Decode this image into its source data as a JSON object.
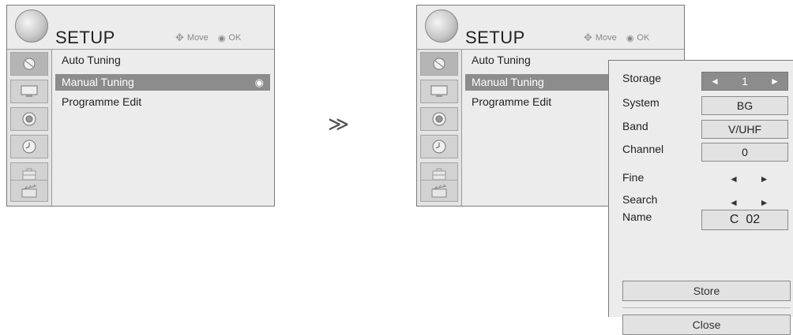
{
  "left_menu": {
    "title": "SETUP",
    "hint_move": "Move",
    "hint_ok": "OK",
    "items": [
      "Auto Tuning",
      "Manual Tuning",
      "Programme Edit"
    ],
    "selected_index": 1
  },
  "transition_symbol": "≫",
  "right_menu": {
    "title": "SETUP",
    "hint_move": "Move",
    "hint_ok": "OK",
    "items": [
      "Auto Tuning",
      "Manual Tuning",
      "Programme Edit"
    ],
    "selected_index": 1
  },
  "manual_tuning_panel": {
    "storage_label": "Storage",
    "storage_value": "1",
    "system_label": "System",
    "system_value": "BG",
    "band_label": "Band",
    "band_value": "V/UHF",
    "channel_label": "Channel",
    "channel_value": "0",
    "fine_label": "Fine",
    "search_label": "Search",
    "name_label": "Name",
    "name_value": "C  02",
    "store_button": "Store",
    "close_button": "Close",
    "arrow_left": "◄",
    "arrow_right": "►"
  },
  "rail_icons": [
    "satellite-dish-icon",
    "monitor-icon",
    "speaker-icon",
    "clock-icon",
    "toolbox-icon",
    "clapperboard-icon"
  ]
}
